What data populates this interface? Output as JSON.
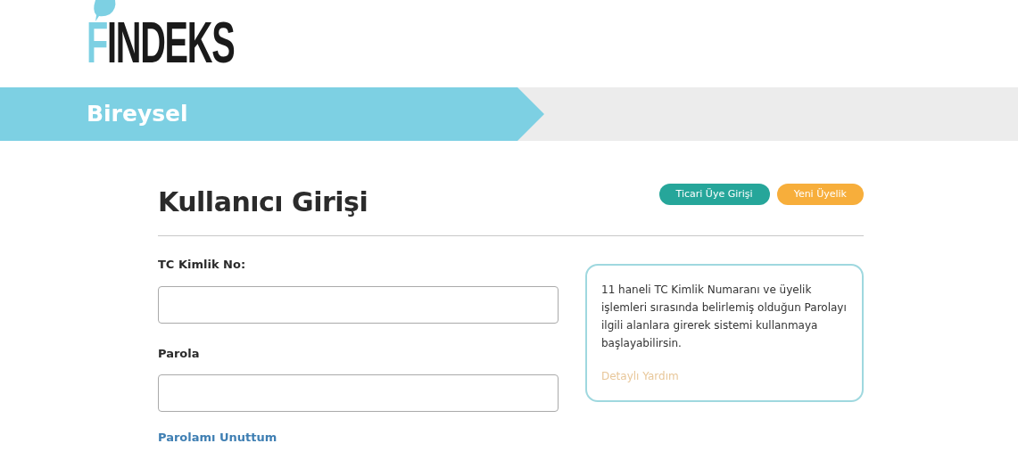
{
  "logo": {
    "text": "FINDEKS"
  },
  "banner": {
    "title": "Bireysel"
  },
  "login": {
    "title": "Kullanıcı Girişi",
    "buttons": [
      {
        "label": "Ticari Üye Girişi",
        "kind": "commercial"
      },
      {
        "label": "Yeni Üyelik",
        "kind": "signup"
      }
    ],
    "fields": [
      {
        "label": "TC Kimlik No:"
      },
      {
        "label": "Parola"
      }
    ],
    "forgot_link": "Parolamı Unuttum",
    "help": {
      "text": "11 haneli TC Kimlik Numaranı ve üyelik işlemleri sırasında belirlemiş olduğun Parolayı ilgili alanlara girerek sistemi kullanmaya başlayabilirsin.",
      "link": "Detaylı Yardım"
    }
  }
}
